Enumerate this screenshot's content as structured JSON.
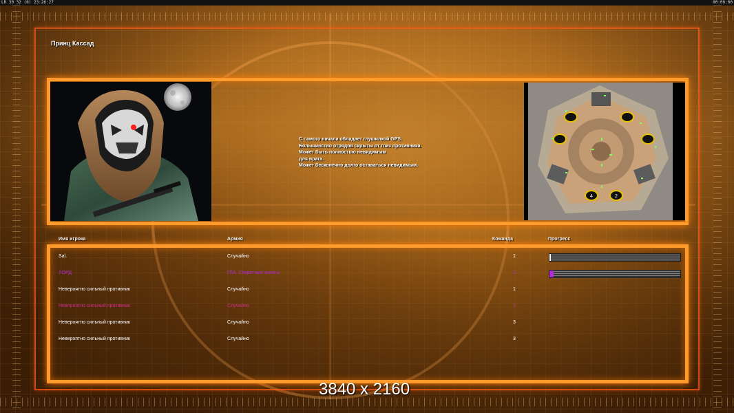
{
  "statusbar": {
    "left": "LR 30 32 (0) 23:26:27",
    "right": "00:00:00"
  },
  "title": "Принц Кассад",
  "description": [
    "С самого начала обладает глушилкой GPS.",
    "Большинство отрядов скрыты от глаз противника.",
    "Может быть полностью невидимым",
    "для врага.",
    "Может бесконечно долго оставаться невидимым."
  ],
  "columns": {
    "player": "Имя игрока",
    "army": "Армия",
    "team": "Команда",
    "progress": "Прогресс"
  },
  "players": [
    {
      "name": "Sal.",
      "army": "Случайно",
      "team": "1",
      "color": "#ffffff",
      "progress": 0.01,
      "progress_color": "#ffffff"
    },
    {
      "name": "ЛОРД",
      "army": "ГЛА. Секретные агенты",
      "team": "1",
      "color": "#b22bd4",
      "progress": 0.03,
      "progress_color": "#b22bd4"
    },
    {
      "name": "Невероятно сильный противник",
      "army": "Случайно",
      "team": "1",
      "color": "#ffffff"
    },
    {
      "name": "Невероятно сильный противник",
      "army": "Случайно",
      "team": "1",
      "color": "#d42b8c"
    },
    {
      "name": "Невероятно сильный противник",
      "army": "Случайно",
      "team": "3",
      "color": "#ffffff"
    },
    {
      "name": "Невероятно сильный противник",
      "army": "Случайно",
      "team": "3",
      "color": "#ffffff"
    }
  ],
  "minimap": {
    "slots": [
      "",
      "",
      "",
      "",
      "4",
      "2"
    ]
  },
  "resolution": "3840 x 2160",
  "colors": {
    "frame": "#ff9a2c",
    "outer_frame": "#ff5a14"
  }
}
